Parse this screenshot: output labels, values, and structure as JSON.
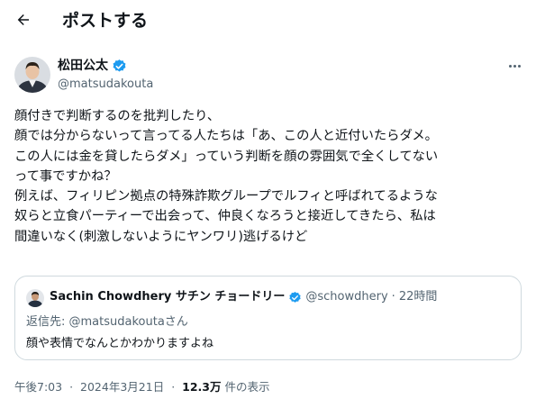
{
  "header": {
    "title": "ポストする",
    "back_icon": "arrow-left-icon"
  },
  "author": {
    "name": "松田公太",
    "handle": "@matsudakouta",
    "verified_color": "#1d9bf0"
  },
  "tweet": {
    "lines": [
      "顔付きで判断するのを批判したり、",
      "顔では分からないって言ってる人たちは「あ、この人と近付いたらダメ。",
      "この人には金を貸したらダメ」っていう判断を顔の雰囲気で全くしてない",
      "って事ですかね？",
      "例えば、フィリピン拠点の特殊詐欺グループでルフィと呼ばれてるような",
      "奴らと立食パーティーで出会って、仲良くなろうと接近してきたら、私は",
      "間違いなく(刺激しないようにヤンワリ)逃げるけど"
    ]
  },
  "quote": {
    "name": "Sachin Chowdhery サチン チョードリー",
    "handle": "@schowdhery",
    "time": "22時間",
    "reply_to": "返信先: @matsudakoutaさん",
    "text": "顔や表情でなんとかわかりますよね"
  },
  "meta": {
    "time": "午後7:03",
    "date": "2024年3月21日",
    "views": "12.3万",
    "views_suffix": "件の表示"
  }
}
